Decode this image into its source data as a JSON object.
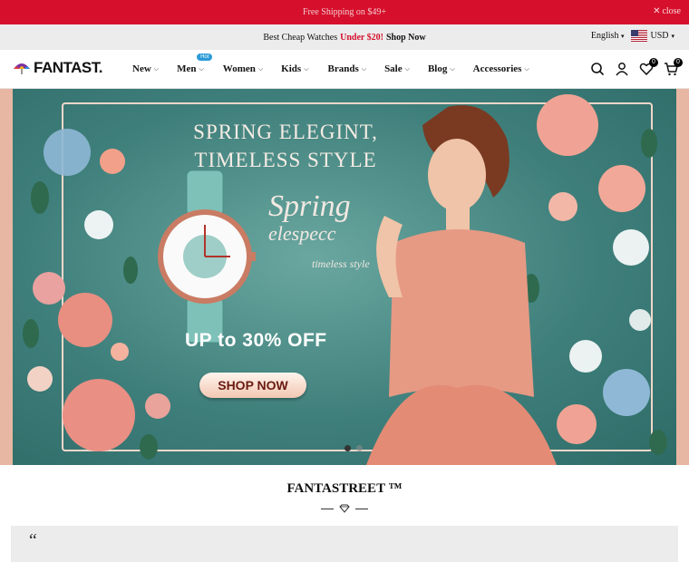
{
  "announcement": {
    "text": "Free Shipping on $49+",
    "close_label": "close"
  },
  "promo": {
    "prefix": "Best Cheap Watches",
    "highlight": "Under $20!",
    "cta": "Shop Now",
    "language": "English",
    "currency": "USD"
  },
  "header": {
    "logo_text": "FANTAST.",
    "nav": [
      {
        "label": "New"
      },
      {
        "label": "Men",
        "badge": "Hot"
      },
      {
        "label": "Women"
      },
      {
        "label": "Kids"
      },
      {
        "label": "Brands"
      },
      {
        "label": "Sale"
      },
      {
        "label": "Blog"
      },
      {
        "label": "Accessories"
      }
    ],
    "wishlist_count": "0",
    "cart_count": "0"
  },
  "hero": {
    "headline_1": "SPRING ELEGINT,",
    "headline_2": "TIMELESS STYLE",
    "script_1": "Spring",
    "script_2": "elespecc",
    "script_3": "timeless style",
    "offer": "UP to 30% OFF",
    "button": "SHOP NOW",
    "active_slide": 1,
    "slide_count": 2
  },
  "section": {
    "title": "FANTASTREET ™",
    "quote_mark": "“"
  },
  "colors": {
    "brand_red": "#d6102c",
    "hero_teal": "#3f7f7b",
    "badge_blue": "#2b9bd8"
  }
}
